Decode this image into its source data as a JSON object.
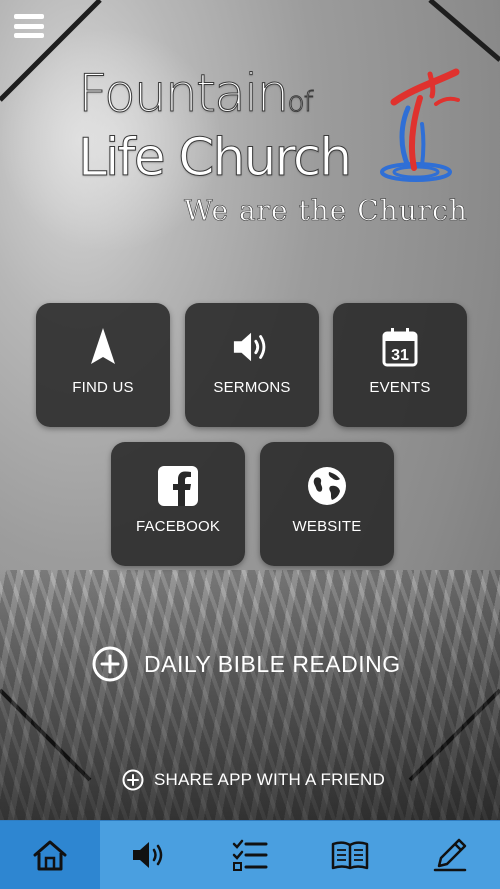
{
  "logo": {
    "line1": "Fountain",
    "line1_small": "of",
    "line2": "Life Church",
    "tagline": "We are the Church"
  },
  "tiles": [
    {
      "label": "FIND US",
      "icon": "navigation-arrow-icon"
    },
    {
      "label": "SERMONS",
      "icon": "speaker-icon"
    },
    {
      "label": "EVENTS",
      "icon": "calendar-icon",
      "day": "31"
    },
    {
      "label": "FACEBOOK",
      "icon": "facebook-icon"
    },
    {
      "label": "WEBSITE",
      "icon": "globe-icon"
    }
  ],
  "daily_reading": "DAILY BIBLE READING",
  "share": "SHARE APP WITH A FRIEND",
  "tabbar": {
    "active_index": 0,
    "items": [
      "home-icon",
      "speaker-icon",
      "checklist-icon",
      "book-icon",
      "pencil-icon"
    ]
  },
  "colors": {
    "tabbar": "#4a9fe0",
    "tab_active": "#2e86d1",
    "tile_bg": "#282828",
    "logo_red": "#e0322e",
    "logo_blue": "#2f6fd6"
  }
}
